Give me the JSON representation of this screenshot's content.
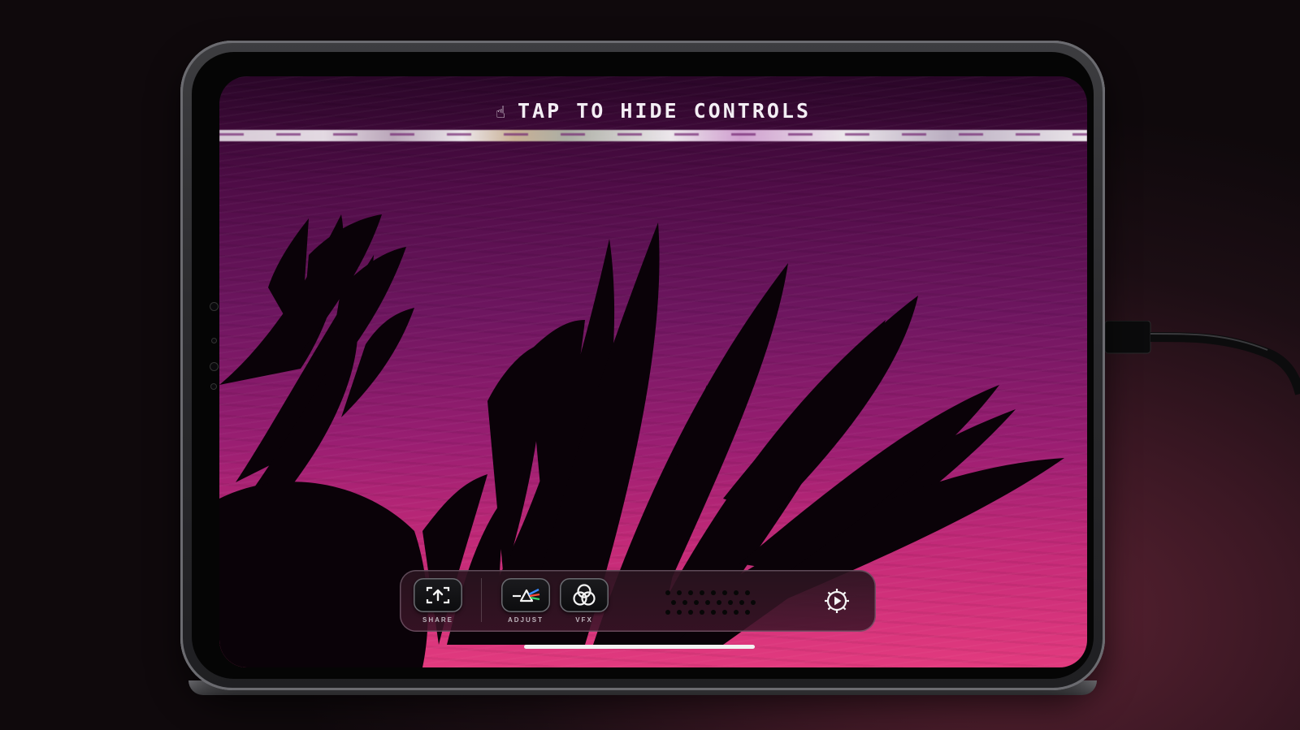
{
  "device": {
    "hint_text": "TAP TO HIDE CONTROLS"
  },
  "toolbar": {
    "share_label": "SHARE",
    "adjust_label": "ADJUST",
    "vfx_label": "VFX"
  },
  "icons": {
    "hint": "hand-icon",
    "share": "share-upload-icon",
    "adjust": "adjust-prism-icon",
    "vfx": "vfx-rings-icon",
    "settings": "gear-play-icon"
  },
  "colors": {
    "screen_top": "#2a0628",
    "screen_mid": "#6e1660",
    "screen_bottom": "#e23a7e",
    "hint_text": "#f3eef4",
    "adjust_accent_red": "#ff4a3a",
    "adjust_accent_blue": "#3a8bff",
    "adjust_accent_green": "#3ad46a"
  }
}
